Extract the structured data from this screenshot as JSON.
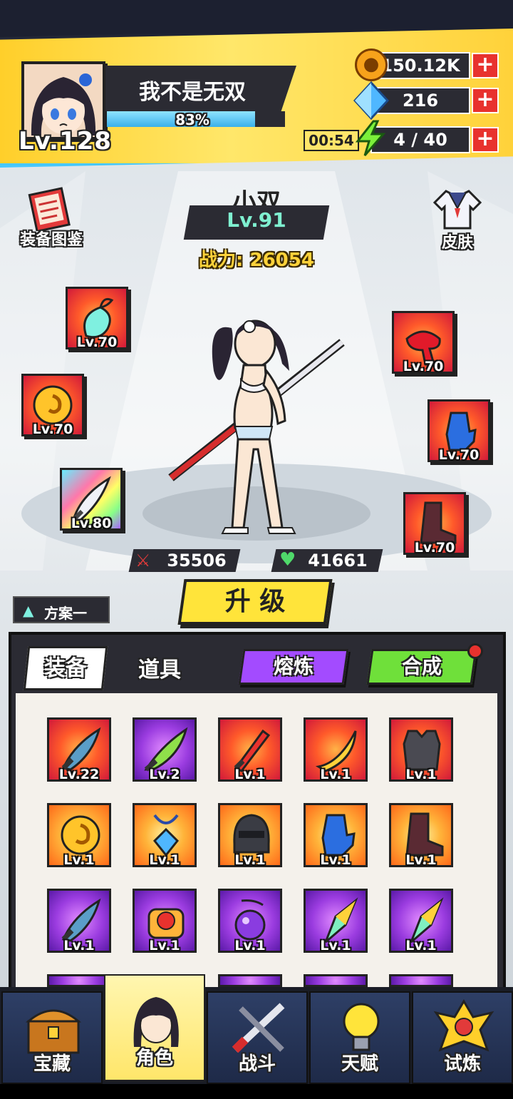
{
  "player": {
    "name": "我不是无双",
    "exp_percent": "83%",
    "exp_fraction": 0.83,
    "level_label": "Lv.",
    "level": "128"
  },
  "resources": {
    "gold": "150.12K",
    "gems": "216",
    "energy_timer": "00:54",
    "energy": "4 / 40"
  },
  "shortcuts": {
    "codex": "装备图鉴",
    "skin": "皮肤"
  },
  "hero": {
    "name": "小双",
    "level": "Lv.91",
    "power_label": "战力:",
    "power": "26054",
    "attack": "35506",
    "hp": "41661"
  },
  "equipped": [
    {
      "icon": "ribbon-charm-icon",
      "level": "Lv.70"
    },
    {
      "icon": "gold-ring-icon",
      "level": "Lv.70"
    },
    {
      "icon": "prism-blade-icon",
      "level": "Lv.80"
    },
    {
      "icon": "red-scarf-icon",
      "level": "Lv.70"
    },
    {
      "icon": "blue-glove-icon",
      "level": "Lv.70"
    },
    {
      "icon": "boot-icon",
      "level": "Lv.70"
    }
  ],
  "upgrade_label": "升 级",
  "preset_label": "方案一",
  "tabs": {
    "equipment": "装备",
    "items": "道具",
    "smelt": "熔炼",
    "combine": "合成"
  },
  "inventory": [
    {
      "icon": "dark-blade-icon",
      "level": "Lv.22",
      "bg": "red"
    },
    {
      "icon": "green-blade-icon",
      "level": "Lv.2",
      "bg": "purple"
    },
    {
      "icon": "red-sword-icon",
      "level": "Lv.1",
      "bg": "red"
    },
    {
      "icon": "yellow-blade-icon",
      "level": "Lv.1",
      "bg": "red"
    },
    {
      "icon": "armor-vest-icon",
      "level": "Lv.1",
      "bg": "red"
    },
    {
      "icon": "gold-ring-icon",
      "level": "Lv.1",
      "bg": "orange"
    },
    {
      "icon": "blue-pendant-icon",
      "level": "Lv.1",
      "bg": "orange"
    },
    {
      "icon": "helmet-icon",
      "level": "Lv.1",
      "bg": "orange"
    },
    {
      "icon": "blue-glove-icon",
      "level": "Lv.1",
      "bg": "orange"
    },
    {
      "icon": "boot-icon",
      "level": "Lv.1",
      "bg": "orange"
    },
    {
      "icon": "dark-blade-icon",
      "level": "Lv.1",
      "bg": "purple"
    },
    {
      "icon": "orange-charm-icon",
      "level": "Lv.1",
      "bg": "purple"
    },
    {
      "icon": "purple-orb-icon",
      "level": "Lv.1",
      "bg": "purple"
    },
    {
      "icon": "crystal-icon",
      "level": "Lv.1",
      "bg": "purple"
    },
    {
      "icon": "crystal-icon",
      "level": "Lv.1",
      "bg": "purple"
    }
  ],
  "nav": [
    {
      "label": "宝藏",
      "icon": "treasure-chest-icon"
    },
    {
      "label": "角色",
      "icon": "character-icon"
    },
    {
      "label": "战斗",
      "icon": "battle-swords-icon"
    },
    {
      "label": "天赋",
      "icon": "lightbulb-icon"
    },
    {
      "label": "试炼",
      "icon": "trial-emblem-icon"
    }
  ],
  "colors": {
    "accent_yellow": "#ffe43a",
    "energy_green": "#7cf03a",
    "nav_active": "#ffe66a"
  }
}
